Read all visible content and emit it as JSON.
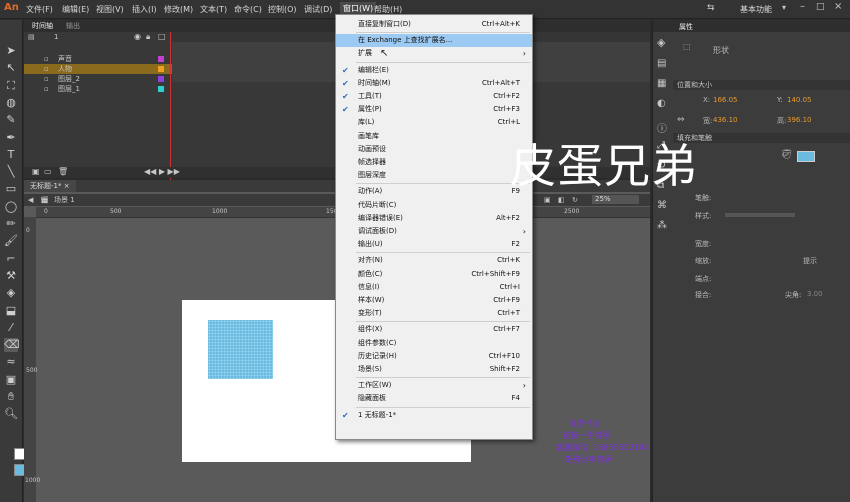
{
  "app": {
    "logo": "An",
    "workspace": "基本功能"
  },
  "menubar": [
    "文件(F)",
    "编辑(E)",
    "视图(V)",
    "插入(I)",
    "修改(M)",
    "文本(T)",
    "命令(C)",
    "控制(O)",
    "调试(D)",
    "窗口(W)",
    "帮助(H)"
  ],
  "timeline": {
    "tabs": [
      "时间轴",
      "输出"
    ],
    "header_label": "1",
    "ruler_num": "15",
    "layers": [
      "声音",
      "人物",
      "图层_2",
      "图层_1"
    ]
  },
  "document": {
    "tab": "无标题-1*",
    "scene": "场景 1",
    "zoom": "25%",
    "ruler_h": [
      "0",
      "500",
      "1000",
      "1500",
      "2000",
      "2500"
    ],
    "ruler_v": [
      "0",
      "500",
      "1000"
    ]
  },
  "props": {
    "tab": "属性",
    "type": "形状",
    "sections": [
      "位置和大小",
      "填充和笔触"
    ],
    "x_label": "X:",
    "x": "166.05",
    "y_label": "Y:",
    "y": "140.05",
    "w_label": "宽:",
    "w": "436.10",
    "h_label": "高:",
    "h": "396.10",
    "stroke": [
      "笔触:",
      "样式:",
      "宽度:",
      "缩放:",
      "端点:",
      "接合:",
      "尖角:"
    ],
    "miter": "3.00",
    "hint": "提示"
  },
  "dropdown": {
    "items": [
      {
        "label": "直接复制窗口(D)",
        "shortcut": "Ctrl+Alt+K"
      },
      {
        "sep": true
      },
      {
        "label": "在 Exchange 上查找扩展名...",
        "highlight": true
      },
      {
        "label": "扩展",
        "submenu": true
      },
      {
        "sep": true
      },
      {
        "label": "编辑栏(E)",
        "check": true
      },
      {
        "label": "时间轴(M)",
        "shortcut": "Ctrl+Alt+T",
        "check": true
      },
      {
        "label": "工具(T)",
        "shortcut": "Ctrl+F2",
        "check": true
      },
      {
        "label": "属性(P)",
        "shortcut": "Ctrl+F3",
        "check": true
      },
      {
        "label": "库(L)",
        "shortcut": "Ctrl+L"
      },
      {
        "label": "画笔库"
      },
      {
        "label": "动画预设"
      },
      {
        "label": "帧选择器"
      },
      {
        "label": "图层深度"
      },
      {
        "sep": true
      },
      {
        "label": "动作(A)",
        "shortcut": "F9"
      },
      {
        "label": "代码片断(C)"
      },
      {
        "label": "编译器错误(E)",
        "shortcut": "Alt+F2"
      },
      {
        "label": "调试面板(D)",
        "submenu": true
      },
      {
        "label": "输出(U)",
        "shortcut": "F2"
      },
      {
        "sep": true
      },
      {
        "label": "对齐(N)",
        "shortcut": "Ctrl+K"
      },
      {
        "label": "颜色(C)",
        "shortcut": "Ctrl+Shift+F9"
      },
      {
        "label": "信息(I)",
        "shortcut": "Ctrl+I"
      },
      {
        "label": "样本(W)",
        "shortcut": "Ctrl+F9"
      },
      {
        "label": "变形(T)",
        "shortcut": "Ctrl+T"
      },
      {
        "sep": true
      },
      {
        "label": "组件(X)",
        "shortcut": "Ctrl+F7"
      },
      {
        "label": "组件参数(C)"
      },
      {
        "label": "历史记录(H)",
        "shortcut": "Ctrl+F10"
      },
      {
        "label": "场景(S)",
        "shortcut": "Shift+F2"
      },
      {
        "sep": true
      },
      {
        "label": "工作区(W)",
        "submenu": true
      },
      {
        "label": "隐藏面板",
        "shortcut": "F4"
      },
      {
        "sep": true
      },
      {
        "label": "1 无标题-1*",
        "check": true
      }
    ]
  },
  "watermark": "皮蛋兄弟",
  "watermark_lines": [
    "白皮书业",
    "安装一手资源",
    "客服微信: 15855552142",
    "免费分享资源"
  ]
}
